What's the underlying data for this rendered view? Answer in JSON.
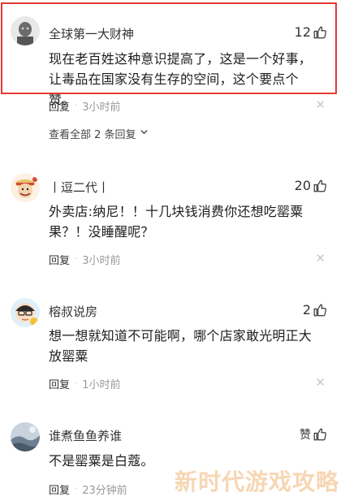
{
  "comments": [
    {
      "username": "全球第一大财神",
      "likes": "12",
      "text": "现在老百姓这种意识提高了，这是一个好事，让毒品在国家没有生存的空间，这个要点个赞。",
      "reply_label": "回复",
      "time": "3小时前",
      "view_all": "查看全部 2 条回复"
    },
    {
      "username": "丨逗二代丨",
      "likes": "20",
      "text": "外卖店:纳尼！！十几块钱消费你还想吃罂粟果？！没睡醒呢？",
      "reply_label": "回复",
      "time": "3小时前"
    },
    {
      "username": "榕叔说房",
      "likes": "2",
      "text": "想一想就知道不可能啊，哪个店家敢光明正大放罂粟",
      "reply_label": "回复",
      "time": "1小时前"
    },
    {
      "username": "谁煮鱼鱼养谁",
      "likes": "赞",
      "text": "不是罂粟是白蔻。",
      "reply_label": "回复",
      "time": "23分钟前"
    }
  ],
  "watermark": "新时代游戏攻略",
  "colors": {
    "highlight": "#e53935",
    "time": "#999999",
    "close": "#c8c8c8"
  },
  "icons": {
    "like": "thumbs-up-icon",
    "close": "close-icon",
    "expand": "chevron-down-icon"
  }
}
